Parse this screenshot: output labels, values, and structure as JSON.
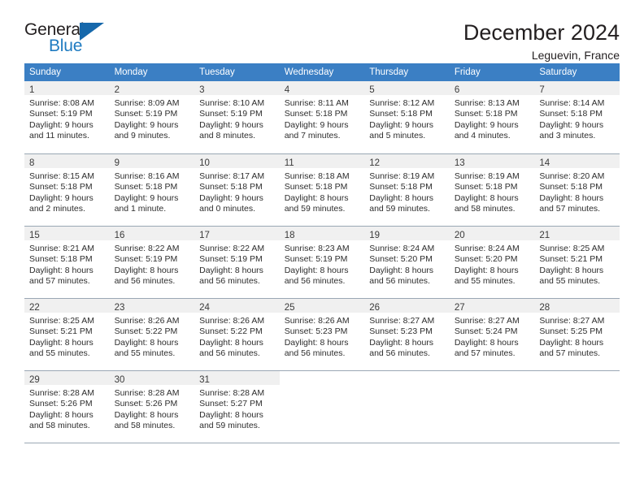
{
  "brand": {
    "name_part1": "General",
    "name_part2": "Blue",
    "flag_icon": "blue-triangle-flag-icon",
    "accent_color": "#1f7bc1"
  },
  "header": {
    "title": "December 2024",
    "location": "Leguevin, France"
  },
  "theme": {
    "header_bg": "#3b7fc4",
    "header_text": "#ffffff",
    "daynum_bg": "#f0f0f0",
    "grid_line": "#9aa7b4",
    "body_text": "#2d2d2d"
  },
  "calendar": {
    "weekday_headers": [
      "Sunday",
      "Monday",
      "Tuesday",
      "Wednesday",
      "Thursday",
      "Friday",
      "Saturday"
    ],
    "weeks": [
      [
        {
          "day": "1",
          "lines": [
            "Sunrise: 8:08 AM",
            "Sunset: 5:19 PM",
            "Daylight: 9 hours",
            "and 11 minutes."
          ]
        },
        {
          "day": "2",
          "lines": [
            "Sunrise: 8:09 AM",
            "Sunset: 5:19 PM",
            "Daylight: 9 hours",
            "and 9 minutes."
          ]
        },
        {
          "day": "3",
          "lines": [
            "Sunrise: 8:10 AM",
            "Sunset: 5:19 PM",
            "Daylight: 9 hours",
            "and 8 minutes."
          ]
        },
        {
          "day": "4",
          "lines": [
            "Sunrise: 8:11 AM",
            "Sunset: 5:18 PM",
            "Daylight: 9 hours",
            "and 7 minutes."
          ]
        },
        {
          "day": "5",
          "lines": [
            "Sunrise: 8:12 AM",
            "Sunset: 5:18 PM",
            "Daylight: 9 hours",
            "and 5 minutes."
          ]
        },
        {
          "day": "6",
          "lines": [
            "Sunrise: 8:13 AM",
            "Sunset: 5:18 PM",
            "Daylight: 9 hours",
            "and 4 minutes."
          ]
        },
        {
          "day": "7",
          "lines": [
            "Sunrise: 8:14 AM",
            "Sunset: 5:18 PM",
            "Daylight: 9 hours",
            "and 3 minutes."
          ]
        }
      ],
      [
        {
          "day": "8",
          "lines": [
            "Sunrise: 8:15 AM",
            "Sunset: 5:18 PM",
            "Daylight: 9 hours",
            "and 2 minutes."
          ]
        },
        {
          "day": "9",
          "lines": [
            "Sunrise: 8:16 AM",
            "Sunset: 5:18 PM",
            "Daylight: 9 hours",
            "and 1 minute."
          ]
        },
        {
          "day": "10",
          "lines": [
            "Sunrise: 8:17 AM",
            "Sunset: 5:18 PM",
            "Daylight: 9 hours",
            "and 0 minutes."
          ]
        },
        {
          "day": "11",
          "lines": [
            "Sunrise: 8:18 AM",
            "Sunset: 5:18 PM",
            "Daylight: 8 hours",
            "and 59 minutes."
          ]
        },
        {
          "day": "12",
          "lines": [
            "Sunrise: 8:19 AM",
            "Sunset: 5:18 PM",
            "Daylight: 8 hours",
            "and 59 minutes."
          ]
        },
        {
          "day": "13",
          "lines": [
            "Sunrise: 8:19 AM",
            "Sunset: 5:18 PM",
            "Daylight: 8 hours",
            "and 58 minutes."
          ]
        },
        {
          "day": "14",
          "lines": [
            "Sunrise: 8:20 AM",
            "Sunset: 5:18 PM",
            "Daylight: 8 hours",
            "and 57 minutes."
          ]
        }
      ],
      [
        {
          "day": "15",
          "lines": [
            "Sunrise: 8:21 AM",
            "Sunset: 5:18 PM",
            "Daylight: 8 hours",
            "and 57 minutes."
          ]
        },
        {
          "day": "16",
          "lines": [
            "Sunrise: 8:22 AM",
            "Sunset: 5:19 PM",
            "Daylight: 8 hours",
            "and 56 minutes."
          ]
        },
        {
          "day": "17",
          "lines": [
            "Sunrise: 8:22 AM",
            "Sunset: 5:19 PM",
            "Daylight: 8 hours",
            "and 56 minutes."
          ]
        },
        {
          "day": "18",
          "lines": [
            "Sunrise: 8:23 AM",
            "Sunset: 5:19 PM",
            "Daylight: 8 hours",
            "and 56 minutes."
          ]
        },
        {
          "day": "19",
          "lines": [
            "Sunrise: 8:24 AM",
            "Sunset: 5:20 PM",
            "Daylight: 8 hours",
            "and 56 minutes."
          ]
        },
        {
          "day": "20",
          "lines": [
            "Sunrise: 8:24 AM",
            "Sunset: 5:20 PM",
            "Daylight: 8 hours",
            "and 55 minutes."
          ]
        },
        {
          "day": "21",
          "lines": [
            "Sunrise: 8:25 AM",
            "Sunset: 5:21 PM",
            "Daylight: 8 hours",
            "and 55 minutes."
          ]
        }
      ],
      [
        {
          "day": "22",
          "lines": [
            "Sunrise: 8:25 AM",
            "Sunset: 5:21 PM",
            "Daylight: 8 hours",
            "and 55 minutes."
          ]
        },
        {
          "day": "23",
          "lines": [
            "Sunrise: 8:26 AM",
            "Sunset: 5:22 PM",
            "Daylight: 8 hours",
            "and 55 minutes."
          ]
        },
        {
          "day": "24",
          "lines": [
            "Sunrise: 8:26 AM",
            "Sunset: 5:22 PM",
            "Daylight: 8 hours",
            "and 56 minutes."
          ]
        },
        {
          "day": "25",
          "lines": [
            "Sunrise: 8:26 AM",
            "Sunset: 5:23 PM",
            "Daylight: 8 hours",
            "and 56 minutes."
          ]
        },
        {
          "day": "26",
          "lines": [
            "Sunrise: 8:27 AM",
            "Sunset: 5:23 PM",
            "Daylight: 8 hours",
            "and 56 minutes."
          ]
        },
        {
          "day": "27",
          "lines": [
            "Sunrise: 8:27 AM",
            "Sunset: 5:24 PM",
            "Daylight: 8 hours",
            "and 57 minutes."
          ]
        },
        {
          "day": "28",
          "lines": [
            "Sunrise: 8:27 AM",
            "Sunset: 5:25 PM",
            "Daylight: 8 hours",
            "and 57 minutes."
          ]
        }
      ],
      [
        {
          "day": "29",
          "lines": [
            "Sunrise: 8:28 AM",
            "Sunset: 5:26 PM",
            "Daylight: 8 hours",
            "and 58 minutes."
          ]
        },
        {
          "day": "30",
          "lines": [
            "Sunrise: 8:28 AM",
            "Sunset: 5:26 PM",
            "Daylight: 8 hours",
            "and 58 minutes."
          ]
        },
        {
          "day": "31",
          "lines": [
            "Sunrise: 8:28 AM",
            "Sunset: 5:27 PM",
            "Daylight: 8 hours",
            "and 59 minutes."
          ]
        },
        {
          "day": "",
          "lines": []
        },
        {
          "day": "",
          "lines": []
        },
        {
          "day": "",
          "lines": []
        },
        {
          "day": "",
          "lines": []
        }
      ]
    ]
  }
}
